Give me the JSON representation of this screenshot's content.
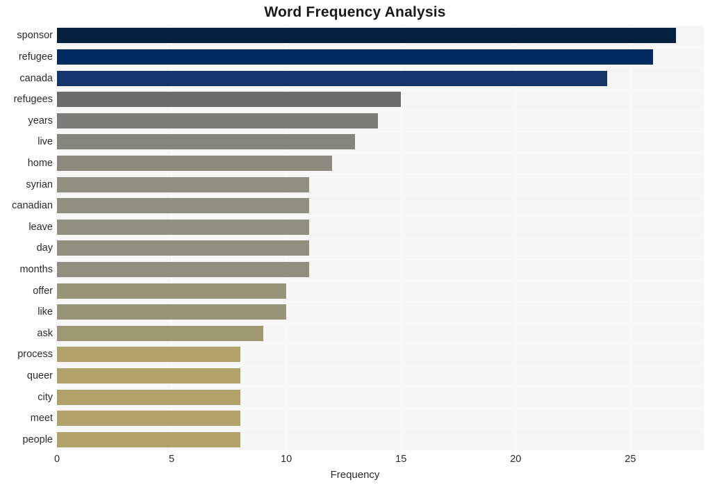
{
  "chart_data": {
    "type": "bar",
    "orientation": "horizontal",
    "title": "Word Frequency Analysis",
    "xlabel": "Frequency",
    "ylabel": "",
    "categories": [
      "sponsor",
      "refugee",
      "canada",
      "refugees",
      "years",
      "live",
      "home",
      "syrian",
      "canadian",
      "leave",
      "day",
      "months",
      "offer",
      "like",
      "ask",
      "process",
      "queer",
      "city",
      "meet",
      "people"
    ],
    "values": [
      27,
      26,
      24,
      15,
      14,
      13,
      12,
      11,
      11,
      11,
      11,
      11,
      10,
      10,
      9,
      8,
      8,
      8,
      8,
      8
    ],
    "bar_colors": [
      "#04203f",
      "#002b5e",
      "#15356d",
      "#6b6c6e",
      "#7c7c78",
      "#85857c",
      "#8b8a7c",
      "#918f7e",
      "#918f7e",
      "#918f7e",
      "#918f7e",
      "#918f7e",
      "#989478",
      "#989478",
      "#9e9972",
      "#b0a269",
      "#b0a269",
      "#b0a269",
      "#b0a269",
      "#b0a269"
    ],
    "xticks": [
      0,
      5,
      10,
      15,
      20,
      25
    ],
    "xlim": [
      0,
      28.2
    ],
    "grid": true,
    "legend": "none",
    "plot_background": "#f6f6f6",
    "gridline_color": "#ffffff"
  }
}
